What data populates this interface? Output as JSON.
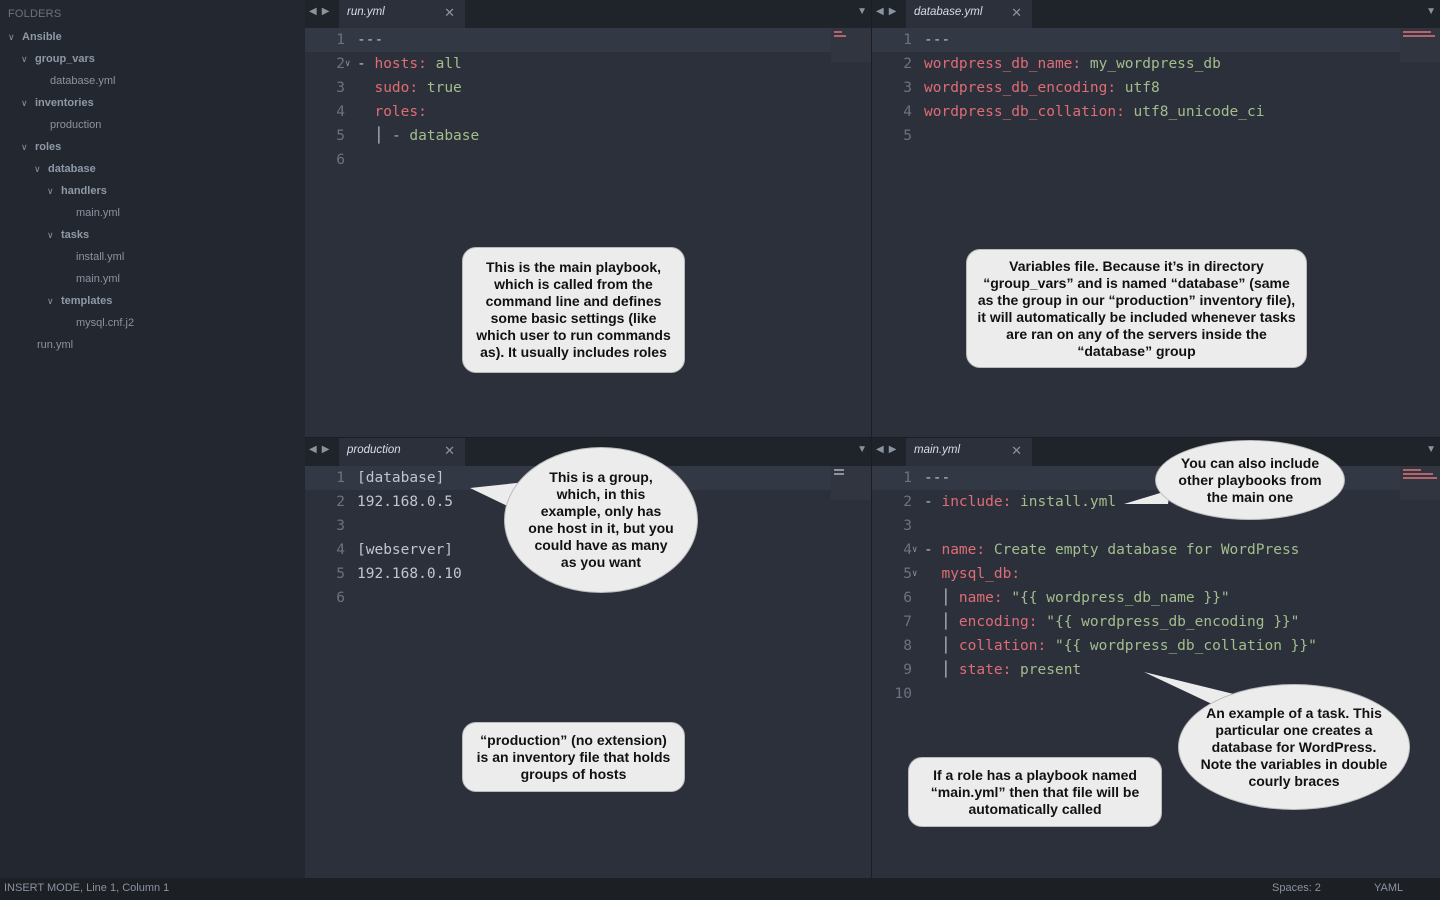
{
  "sidebar": {
    "title": "FOLDERS",
    "tree": [
      {
        "label": "Ansible",
        "type": "folder",
        "depth": 0
      },
      {
        "label": "group_vars",
        "type": "folder",
        "depth": 1
      },
      {
        "label": "database.yml",
        "type": "file",
        "depth": 2
      },
      {
        "label": "inventories",
        "type": "folder",
        "depth": 1
      },
      {
        "label": "production",
        "type": "file",
        "depth": 2
      },
      {
        "label": "roles",
        "type": "folder",
        "depth": 1
      },
      {
        "label": "database",
        "type": "folder",
        "depth": 2
      },
      {
        "label": "handlers",
        "type": "folder",
        "depth": 3
      },
      {
        "label": "main.yml",
        "type": "file",
        "depth": 4
      },
      {
        "label": "tasks",
        "type": "folder",
        "depth": 3
      },
      {
        "label": "install.yml",
        "type": "file",
        "depth": 4
      },
      {
        "label": "main.yml",
        "type": "file",
        "depth": 4
      },
      {
        "label": "templates",
        "type": "folder",
        "depth": 3
      },
      {
        "label": "mysql.cnf.j2",
        "type": "file",
        "depth": 4
      },
      {
        "label": "run.yml",
        "type": "file",
        "depth": 1
      }
    ]
  },
  "panes": [
    {
      "tab": "run.yml",
      "lines": [
        [
          [
            "p",
            "---"
          ]
        ],
        [
          [
            "p",
            "- "
          ],
          [
            "k",
            "hosts"
          ],
          [
            "k",
            ": "
          ],
          [
            "v",
            "all"
          ]
        ],
        [
          [
            "p",
            "  "
          ],
          [
            "k",
            "sudo"
          ],
          [
            "k",
            ": "
          ],
          [
            "v",
            "true"
          ]
        ],
        [
          [
            "p",
            "  "
          ],
          [
            "k",
            "roles"
          ],
          [
            "k",
            ":"
          ]
        ],
        [
          [
            "p",
            "  "
          ],
          [
            "p",
            "│ "
          ],
          [
            "v",
            "- database"
          ]
        ],
        []
      ],
      "folds": [
        2
      ]
    },
    {
      "tab": "database.yml",
      "lines": [
        [
          [
            "p",
            "---"
          ]
        ],
        [
          [
            "k",
            "wordpress_db_name"
          ],
          [
            "k",
            ": "
          ],
          [
            "v",
            "my_wordpress_db"
          ]
        ],
        [
          [
            "k",
            "wordpress_db_encoding"
          ],
          [
            "k",
            ": "
          ],
          [
            "v",
            "utf8"
          ]
        ],
        [
          [
            "k",
            "wordpress_db_collation"
          ],
          [
            "k",
            ": "
          ],
          [
            "v",
            "utf8_unicode_ci"
          ]
        ],
        []
      ],
      "folds": []
    },
    {
      "tab": "production",
      "lines": [
        [
          [
            "p",
            "[database]"
          ]
        ],
        [
          [
            "p",
            "192.168.0.5"
          ]
        ],
        [],
        [
          [
            "p",
            "[webserver]"
          ]
        ],
        [
          [
            "p",
            "192.168.0.10"
          ]
        ],
        []
      ],
      "folds": []
    },
    {
      "tab": "main.yml",
      "lines": [
        [
          [
            "p",
            "---"
          ]
        ],
        [
          [
            "p",
            "- "
          ],
          [
            "k",
            "include"
          ],
          [
            "k",
            ": "
          ],
          [
            "v",
            "install.yml"
          ]
        ],
        [],
        [
          [
            "p",
            "- "
          ],
          [
            "k",
            "name"
          ],
          [
            "k",
            ": "
          ],
          [
            "v",
            "Create empty database for WordPress"
          ]
        ],
        [
          [
            "p",
            "  "
          ],
          [
            "k",
            "mysql_db"
          ],
          [
            "k",
            ":"
          ]
        ],
        [
          [
            "p",
            "  │ "
          ],
          [
            "k",
            "name"
          ],
          [
            "k",
            ": "
          ],
          [
            "v",
            "\"{{ wordpress_db_name }}\""
          ]
        ],
        [
          [
            "p",
            "  │ "
          ],
          [
            "k",
            "encoding"
          ],
          [
            "k",
            ": "
          ],
          [
            "v",
            "\"{{ wordpress_db_encoding }}\""
          ]
        ],
        [
          [
            "p",
            "  │ "
          ],
          [
            "k",
            "collation"
          ],
          [
            "k",
            ": "
          ],
          [
            "v",
            "\"{{ wordpress_db_collation }}\""
          ]
        ],
        [
          [
            "p",
            "  │ "
          ],
          [
            "k",
            "state"
          ],
          [
            "k",
            ": "
          ],
          [
            "v",
            "present"
          ]
        ],
        []
      ],
      "folds": [
        4,
        5
      ]
    }
  ],
  "callouts": {
    "main_playbook": "This is the main playbook, which is called from the command line and defines some basic settings (like which user to run commands as). It usually includes roles",
    "variables_file": "Variables file. Because it’s in directory “group_vars” and is named “database” (same as the group in our “production” inventory file), it will automatically be included whenever tasks are ran on any of the servers inside  the “database” group",
    "group": "This is a group, which, in this example, only has one host in it, but you could have as many as you want",
    "inventory": "“production” (no extension) is an inventory file that holds groups of hosts",
    "include_other": "You can also include other playbooks from the main one",
    "task_example": "An example of a task. This particular one creates a database for WordPress. Note the variables in double courly braces",
    "role_main": "If a role has a playbook named “main.yml” then that file will be automatically called"
  },
  "statusbar": {
    "mode": "INSERT MODE, Line 1, Column 1",
    "spaces": "Spaces: 2",
    "syntax": "YAML"
  },
  "colors": {
    "key": "#e06c75",
    "value": "#a3be8c",
    "background": "#2b303b",
    "sidebar": "#232830"
  }
}
